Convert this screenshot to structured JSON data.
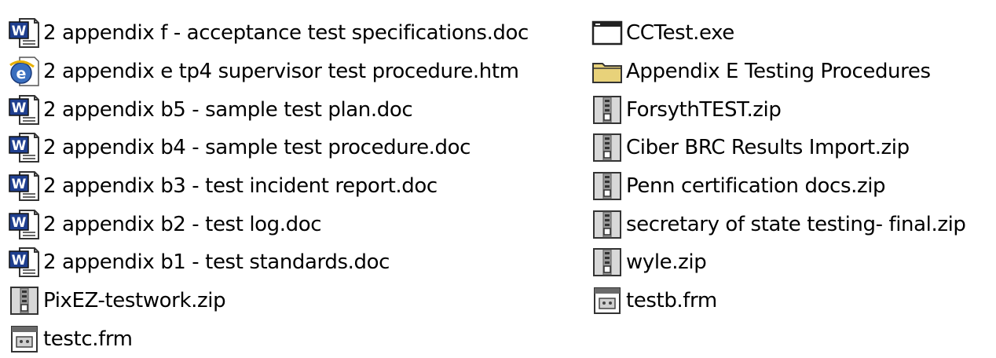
{
  "window": {
    "view": "list"
  },
  "colors": {
    "word_icon": "#1f3f8f",
    "ie_icon": "#3a6fbf",
    "folder_icon": "#e8d27a",
    "zip_icon": "#c8c8c8",
    "form_icon": "#6a6a6a"
  },
  "files": {
    "left": [
      {
        "name": "2 appendix f - acceptance test specifications.doc",
        "icon": "word-doc-icon"
      },
      {
        "name": "2 appendix e tp4 supervisor test procedure.htm",
        "icon": "ie-html-icon"
      },
      {
        "name": "2 appendix b5 - sample test plan.doc",
        "icon": "word-doc-icon"
      },
      {
        "name": "2 appendix b4 - sample test procedure.doc",
        "icon": "word-doc-icon"
      },
      {
        "name": "2 appendix b3 - test incident report.doc",
        "icon": "word-doc-icon"
      },
      {
        "name": "2 appendix b2 - test log.doc",
        "icon": "word-doc-icon"
      },
      {
        "name": "2 appendix b1 - test standards.doc",
        "icon": "word-doc-icon"
      },
      {
        "name": "PixEZ-testwork.zip",
        "icon": "zip-archive-icon"
      },
      {
        "name": "testc.frm",
        "icon": "form-file-icon"
      }
    ],
    "right": [
      {
        "name": "CCTest.exe",
        "icon": "application-window-icon"
      },
      {
        "name": "Appendix E Testing Procedures",
        "icon": "folder-icon"
      },
      {
        "name": "ForsythTEST.zip",
        "icon": "zip-archive-icon"
      },
      {
        "name": "Ciber BRC Results Import.zip",
        "icon": "zip-archive-icon"
      },
      {
        "name": "Penn certification docs.zip",
        "icon": "zip-archive-icon"
      },
      {
        "name": "secretary of state testing- final.zip",
        "icon": "zip-archive-icon"
      },
      {
        "name": "wyle.zip",
        "icon": "zip-archive-icon"
      },
      {
        "name": "testb.frm",
        "icon": "form-file-icon"
      }
    ]
  }
}
